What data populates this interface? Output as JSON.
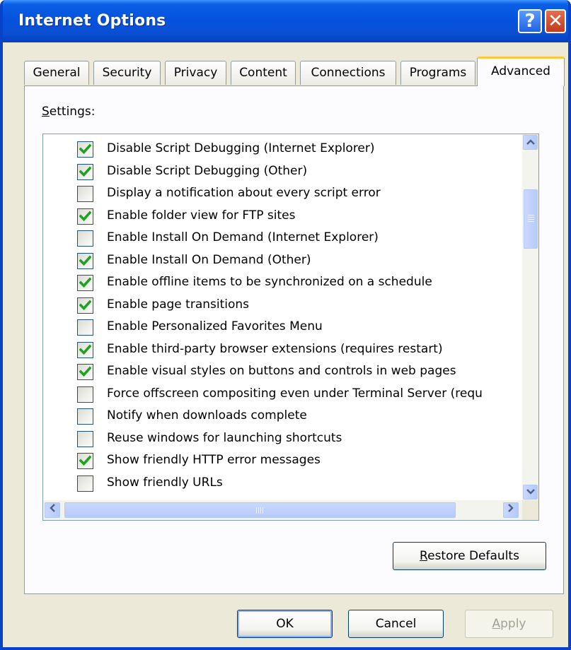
{
  "window": {
    "title": "Internet Options",
    "help_glyph": "?",
    "close_glyph": "✕"
  },
  "tabs": [
    {
      "label": "General"
    },
    {
      "label": "Security"
    },
    {
      "label": "Privacy"
    },
    {
      "label": "Content"
    },
    {
      "label": "Connections"
    },
    {
      "label": "Programs"
    },
    {
      "label": "Advanced"
    }
  ],
  "active_tab": "Advanced",
  "settings_label": {
    "first": "S",
    "rest": "ettings:"
  },
  "settings": [
    {
      "label": "Disable Script Debugging (Internet Explorer)",
      "checked": true
    },
    {
      "label": "Disable Script Debugging (Other)",
      "checked": true
    },
    {
      "label": "Display a notification about every script error",
      "checked": false
    },
    {
      "label": "Enable folder view for FTP sites",
      "checked": true
    },
    {
      "label": "Enable Install On Demand (Internet Explorer)",
      "checked": false
    },
    {
      "label": "Enable Install On Demand (Other)",
      "checked": true
    },
    {
      "label": "Enable offline items to be synchronized on a schedule",
      "checked": true
    },
    {
      "label": "Enable page transitions",
      "checked": true
    },
    {
      "label": "Enable Personalized Favorites Menu",
      "checked": false
    },
    {
      "label": "Enable third-party browser extensions (requires restart)",
      "checked": true
    },
    {
      "label": "Enable visual styles on buttons and controls in web pages",
      "checked": true
    },
    {
      "label": "Force offscreen compositing even under Terminal Server (requ",
      "checked": false
    },
    {
      "label": "Notify when downloads complete",
      "checked": false
    },
    {
      "label": "Reuse windows for launching shortcuts",
      "checked": false
    },
    {
      "label": "Show friendly HTTP error messages",
      "checked": true
    },
    {
      "label": "Show friendly URLs",
      "checked": false
    }
  ],
  "buttons": {
    "restore_first": "R",
    "restore_rest": "estore Defaults",
    "ok": "OK",
    "cancel": "Cancel",
    "apply_first": "A",
    "apply_rest": "pply"
  },
  "colors": {
    "titlebar": "#0553de",
    "check": "#21a121",
    "active_tab_accent": "#ffc83c"
  }
}
